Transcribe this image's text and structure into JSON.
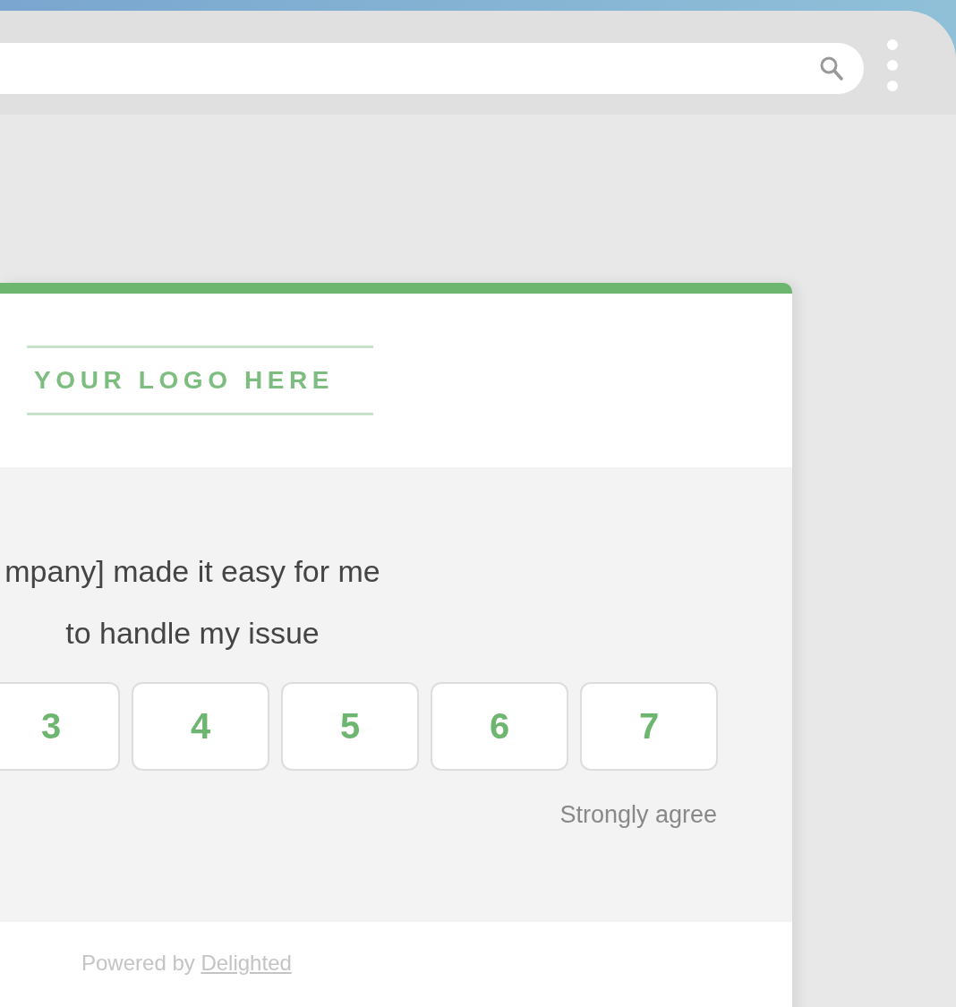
{
  "survey": {
    "logo": "YOUR LOGO HERE",
    "question": "mpany] made it easy for me to handle my issue",
    "scale": [
      {
        "label": "3"
      },
      {
        "label": "4"
      },
      {
        "label": "5"
      },
      {
        "label": "6"
      },
      {
        "label": "7"
      }
    ],
    "high_label": "Strongly agree",
    "footer": {
      "text": "Powered by",
      "link": "Delighted"
    }
  }
}
